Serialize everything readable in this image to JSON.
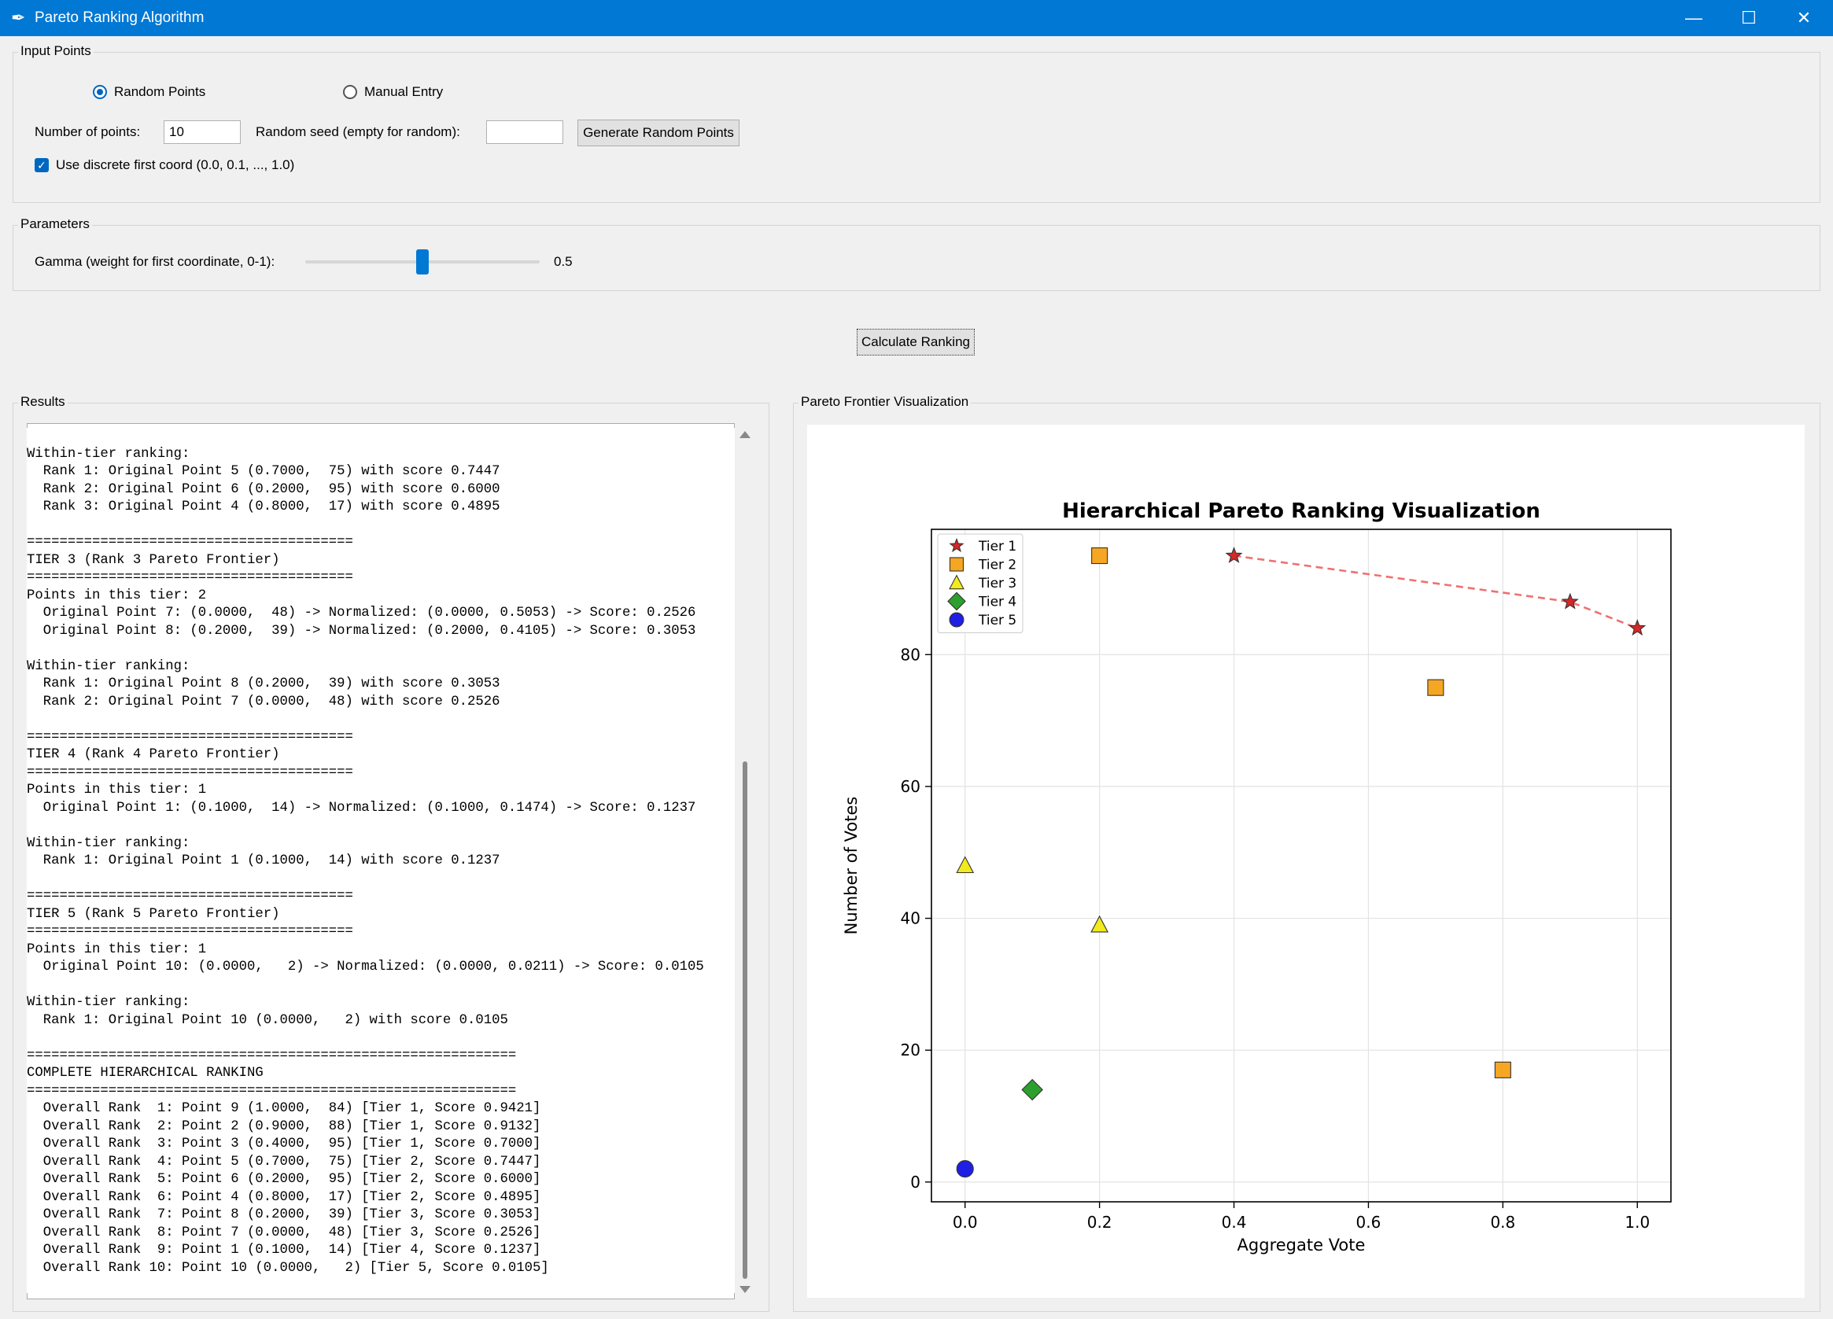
{
  "window": {
    "title": "Pareto Ranking Algorithm",
    "minimize": "—",
    "maximize": "☐",
    "close": "✕"
  },
  "input_points": {
    "group_label": "Input Points",
    "random_label": "Random Points",
    "manual_label": "Manual Entry",
    "mode_selected": "Random Points",
    "num_points_label": "Number of points:",
    "num_points_value": "10",
    "seed_label": "Random seed (empty for random):",
    "seed_value": "",
    "generate_button": "Generate Random Points",
    "discrete_label": "Use discrete first coord (0.0, 0.1, ..., 1.0)",
    "discrete_checked": true
  },
  "parameters": {
    "group_label": "Parameters",
    "gamma_label": "Gamma (weight for first coordinate, 0-1):",
    "gamma_value": "0.5",
    "gamma_level": 0.5
  },
  "calculate_button": "Calculate Ranking",
  "results": {
    "group_label": "Results",
    "text": "\nWithin-tier ranking:\n  Rank 1: Original Point 5 (0.7000,  75) with score 0.7447\n  Rank 2: Original Point 6 (0.2000,  95) with score 0.6000\n  Rank 3: Original Point 4 (0.8000,  17) with score 0.4895\n\n========================================\nTIER 3 (Rank 3 Pareto Frontier)\n========================================\nPoints in this tier: 2\n  Original Point 7: (0.0000,  48) -> Normalized: (0.0000, 0.5053) -> Score: 0.2526\n  Original Point 8: (0.2000,  39) -> Normalized: (0.2000, 0.4105) -> Score: 0.3053\n\nWithin-tier ranking:\n  Rank 1: Original Point 8 (0.2000,  39) with score 0.3053\n  Rank 2: Original Point 7 (0.0000,  48) with score 0.2526\n\n========================================\nTIER 4 (Rank 4 Pareto Frontier)\n========================================\nPoints in this tier: 1\n  Original Point 1: (0.1000,  14) -> Normalized: (0.1000, 0.1474) -> Score: 0.1237\n\nWithin-tier ranking:\n  Rank 1: Original Point 1 (0.1000,  14) with score 0.1237\n\n========================================\nTIER 5 (Rank 5 Pareto Frontier)\n========================================\nPoints in this tier: 1\n  Original Point 10: (0.0000,   2) -> Normalized: (0.0000, 0.0211) -> Score: 0.0105\n\nWithin-tier ranking:\n  Rank 1: Original Point 10 (0.0000,   2) with score 0.0105\n\n============================================================\nCOMPLETE HIERARCHICAL RANKING\n============================================================\n  Overall Rank  1: Point 9 (1.0000,  84) [Tier 1, Score 0.9421]\n  Overall Rank  2: Point 2 (0.9000,  88) [Tier 1, Score 0.9132]\n  Overall Rank  3: Point 3 (0.4000,  95) [Tier 1, Score 0.7000]\n  Overall Rank  4: Point 5 (0.7000,  75) [Tier 2, Score 0.7447]\n  Overall Rank  5: Point 6 (0.2000,  95) [Tier 2, Score 0.6000]\n  Overall Rank  6: Point 4 (0.8000,  17) [Tier 2, Score 0.4895]\n  Overall Rank  7: Point 8 (0.2000,  39) [Tier 3, Score 0.3053]\n  Overall Rank  8: Point 7 (0.0000,  48) [Tier 3, Score 0.2526]\n  Overall Rank  9: Point 1 (0.1000,  14) [Tier 4, Score 0.1237]\n  Overall Rank 10: Point 10 (0.0000,   2) [Tier 5, Score 0.0105]"
  },
  "visualization": {
    "group_label": "Pareto Frontier Visualization"
  },
  "chart_data": {
    "type": "scatter",
    "title": "Hierarchical Pareto Ranking Visualization",
    "xlabel": "Aggregate Vote",
    "ylabel": "Number of Votes",
    "xlim": [
      -0.05,
      1.05
    ],
    "ylim": [
      -3,
      99
    ],
    "xticks": [
      0.0,
      0.2,
      0.4,
      0.6,
      0.8,
      1.0
    ],
    "xtick_labels": [
      "0.0",
      "0.2",
      "0.4",
      "0.6",
      "0.8",
      "1.0"
    ],
    "yticks": [
      0,
      20,
      40,
      60,
      80
    ],
    "ytick_labels": [
      "0",
      "20",
      "40",
      "60",
      "80"
    ],
    "grid": true,
    "legend_position": "top-left",
    "series": [
      {
        "name": "Tier 1",
        "marker": "star",
        "color": "#d62728",
        "points": [
          [
            0.4,
            95
          ],
          [
            0.9,
            88
          ],
          [
            1.0,
            84
          ]
        ],
        "frontier_line": true
      },
      {
        "name": "Tier 2",
        "marker": "square",
        "color": "#f5a623",
        "points": [
          [
            0.2,
            95
          ],
          [
            0.7,
            75
          ],
          [
            0.8,
            17
          ]
        ]
      },
      {
        "name": "Tier 3",
        "marker": "triangle",
        "color": "#f2ea1c",
        "points": [
          [
            0.0,
            48
          ],
          [
            0.2,
            39
          ]
        ]
      },
      {
        "name": "Tier 4",
        "marker": "diamond",
        "color": "#2ca02c",
        "points": [
          [
            0.1,
            14
          ]
        ]
      },
      {
        "name": "Tier 5",
        "marker": "circle",
        "color": "#1f1fe6",
        "points": [
          [
            0.0,
            2
          ]
        ]
      }
    ]
  }
}
